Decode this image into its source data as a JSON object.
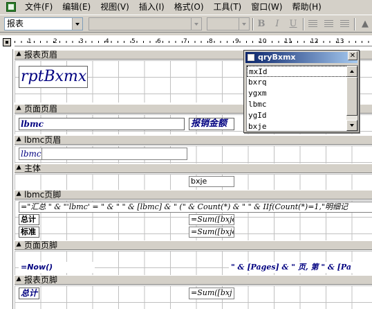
{
  "menu": [
    "文件(F)",
    "编辑(E)",
    "视图(V)",
    "插入(I)",
    "格式(O)",
    "工具(T)",
    "窗口(W)",
    "帮助(H)"
  ],
  "toolbar": {
    "object_value": "报表",
    "bold": "B",
    "italic": "I",
    "underline": "U"
  },
  "ruler": [
    "1",
    "2",
    "3",
    "4",
    "5",
    "6",
    "7",
    "8",
    "9",
    "10",
    "11",
    "12",
    "13"
  ],
  "bands": {
    "report_header": "报表页眉",
    "page_header": "页面页眉",
    "group_header": "lbmc页眉",
    "detail": "主体",
    "group_footer": "lbmc页脚",
    "page_footer": "页面页脚",
    "report_footer": "报表页脚"
  },
  "controls": {
    "title": "rptBxmx",
    "page_lbmc": "lbmc",
    "page_amount": "报销金额",
    "group_lbmc": "lbmc",
    "detail_bxje": "bxje",
    "group_expr": "=\"汇总 \" & \"'lbmc' = \" & \" \" & [lbmc] & \" (\" & Count(*) & \" \" & IIf(Count(*)=1,\"明细记",
    "total_label": "总计",
    "total_sum": "=Sum([bxje",
    "std_label": "标准",
    "std_sum": "=Sum([bxje",
    "now_expr": "=Now()",
    "pages_expr": "\" & [Pages] & \" 页, 第 \" & [Pa",
    "rf_label": "总计",
    "rf_sum": "=Sum([bxj"
  },
  "field_list": {
    "title": "qryBxmx",
    "fields": [
      "mxId",
      "bxrq",
      "ygxm",
      "lbmc",
      "ygId",
      "bxje"
    ]
  }
}
